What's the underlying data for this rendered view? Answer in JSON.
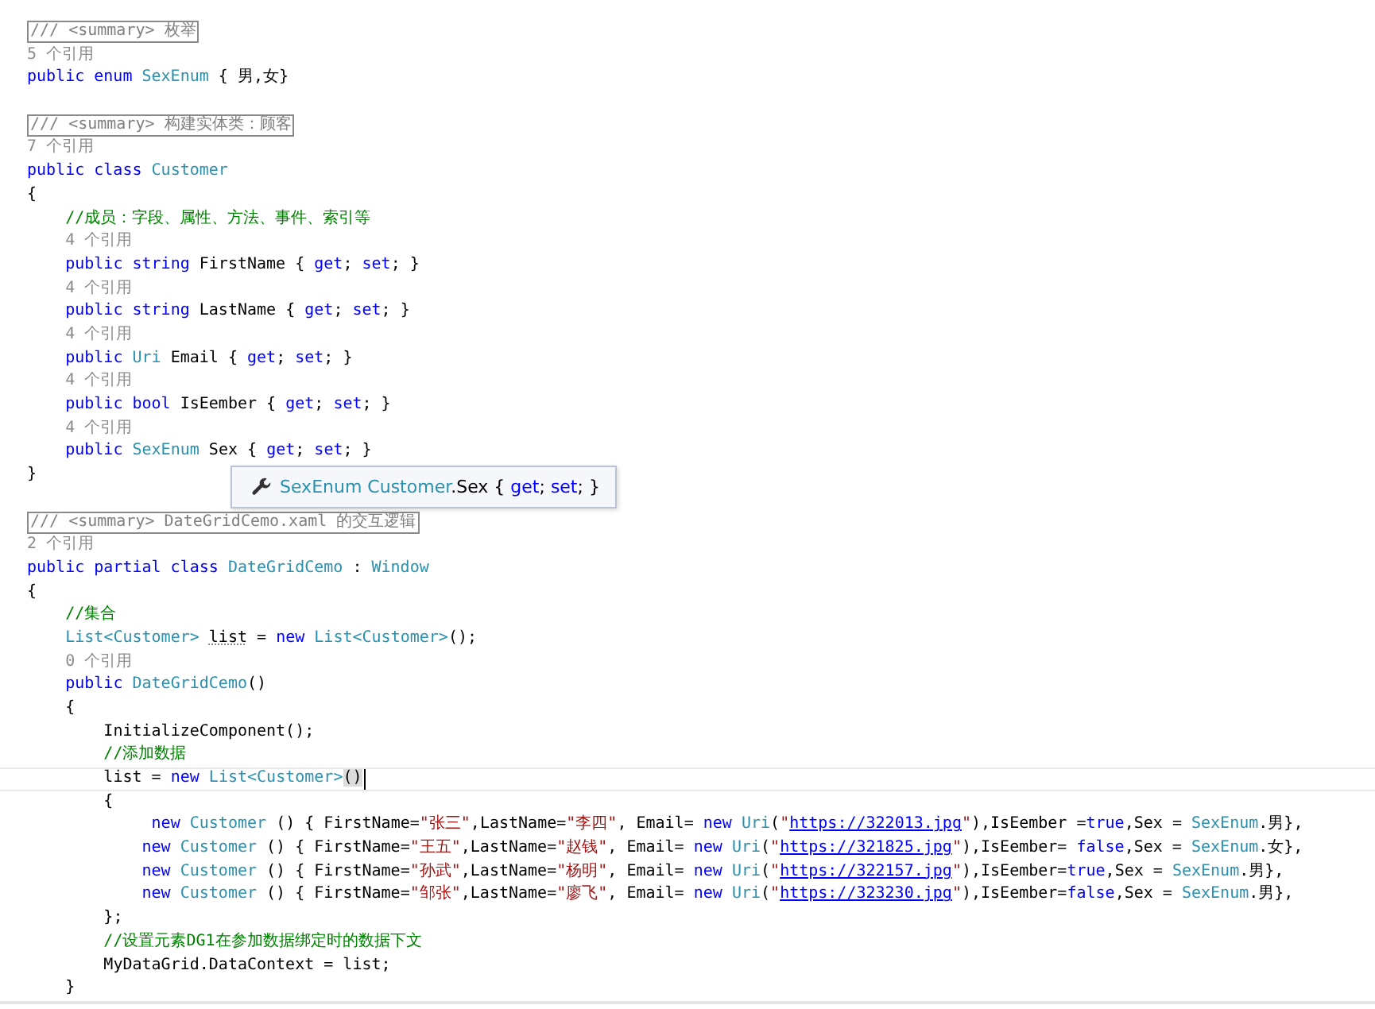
{
  "editor": {
    "lines": [
      {
        "kind": "summary",
        "current": false,
        "text": "/// <summary> 枚举"
      },
      {
        "kind": "refs",
        "current": false,
        "text": "5 个引用"
      },
      {
        "kind": "code",
        "current": false,
        "tokens": [
          {
            "kind": "kw",
            "text": "public enum "
          },
          {
            "kind": "type",
            "text": "SexEnum"
          },
          {
            "kind": "plain",
            "text": " { 男,女}"
          }
        ]
      },
      {
        "kind": "blank",
        "current": false
      },
      {
        "kind": "summary",
        "current": false,
        "text": "/// <summary> 构建实体类：顾客"
      },
      {
        "kind": "refs",
        "current": false,
        "text": "7 个引用"
      },
      {
        "kind": "code",
        "current": false,
        "tokens": [
          {
            "kind": "kw",
            "text": "public class "
          },
          {
            "kind": "type",
            "text": "Customer"
          }
        ]
      },
      {
        "kind": "code",
        "current": false,
        "tokens": [
          {
            "kind": "plain",
            "text": "{"
          }
        ]
      },
      {
        "kind": "code",
        "current": false,
        "tokens": [
          {
            "kind": "comment",
            "text": "    //成员：字段、属性、方法、事件、索引等"
          }
        ]
      },
      {
        "kind": "refs",
        "current": false,
        "text": "    4 个引用"
      },
      {
        "kind": "code",
        "current": false,
        "tokens": [
          {
            "kind": "kw",
            "text": "    public string "
          },
          {
            "kind": "plain",
            "text": "FirstName { "
          },
          {
            "kind": "kw",
            "text": "get"
          },
          {
            "kind": "plain",
            "text": "; "
          },
          {
            "kind": "kw",
            "text": "set"
          },
          {
            "kind": "plain",
            "text": "; }"
          }
        ]
      },
      {
        "kind": "refs",
        "current": false,
        "text": "    4 个引用"
      },
      {
        "kind": "code",
        "current": false,
        "tokens": [
          {
            "kind": "kw",
            "text": "    public string "
          },
          {
            "kind": "plain",
            "text": "LastName { "
          },
          {
            "kind": "kw",
            "text": "get"
          },
          {
            "kind": "plain",
            "text": "; "
          },
          {
            "kind": "kw",
            "text": "set"
          },
          {
            "kind": "plain",
            "text": "; }"
          }
        ]
      },
      {
        "kind": "refs",
        "current": false,
        "text": "    4 个引用"
      },
      {
        "kind": "code",
        "current": false,
        "tokens": [
          {
            "kind": "kw",
            "text": "    public "
          },
          {
            "kind": "type",
            "text": "Uri"
          },
          {
            "kind": "plain",
            "text": " Email { "
          },
          {
            "kind": "kw",
            "text": "get"
          },
          {
            "kind": "plain",
            "text": "; "
          },
          {
            "kind": "kw",
            "text": "set"
          },
          {
            "kind": "plain",
            "text": "; }"
          }
        ]
      },
      {
        "kind": "refs",
        "current": false,
        "text": "    4 个引用"
      },
      {
        "kind": "code",
        "current": false,
        "tokens": [
          {
            "kind": "kw",
            "text": "    public bool "
          },
          {
            "kind": "plain",
            "text": "IsEember { "
          },
          {
            "kind": "kw",
            "text": "get"
          },
          {
            "kind": "plain",
            "text": "; "
          },
          {
            "kind": "kw",
            "text": "set"
          },
          {
            "kind": "plain",
            "text": "; }"
          }
        ]
      },
      {
        "kind": "refs",
        "current": false,
        "text": "    4 个引用"
      },
      {
        "kind": "code",
        "current": false,
        "tokens": [
          {
            "kind": "kw",
            "text": "    public "
          },
          {
            "kind": "type",
            "text": "SexEnum"
          },
          {
            "kind": "plain",
            "text": " Sex { "
          },
          {
            "kind": "kw",
            "text": "get"
          },
          {
            "kind": "plain",
            "text": "; "
          },
          {
            "kind": "kw",
            "text": "set"
          },
          {
            "kind": "plain",
            "text": "; }"
          }
        ]
      },
      {
        "kind": "code",
        "current": false,
        "tokens": [
          {
            "kind": "plain",
            "text": "}"
          }
        ]
      },
      {
        "kind": "blank",
        "current": false
      },
      {
        "kind": "summary",
        "current": false,
        "text": "/// <summary> DateGridCemo.xaml 的交互逻辑"
      },
      {
        "kind": "refs",
        "current": false,
        "text": "2 个引用"
      },
      {
        "kind": "code",
        "current": false,
        "tokens": [
          {
            "kind": "kw",
            "text": "public partial class "
          },
          {
            "kind": "type",
            "text": "DateGridCemo"
          },
          {
            "kind": "plain",
            "text": " : "
          },
          {
            "kind": "type",
            "text": "Window"
          }
        ]
      },
      {
        "kind": "code",
        "current": false,
        "tokens": [
          {
            "kind": "plain",
            "text": "{"
          }
        ]
      },
      {
        "kind": "code",
        "current": false,
        "tokens": [
          {
            "kind": "comment",
            "text": "    //集合"
          }
        ]
      },
      {
        "kind": "code",
        "current": false,
        "tokens": [
          {
            "kind": "type",
            "text": "    List<Customer> "
          },
          {
            "kind": "suggest",
            "text": "list"
          },
          {
            "kind": "plain",
            "text": " = "
          },
          {
            "kind": "kw",
            "text": "new "
          },
          {
            "kind": "type",
            "text": "List<Customer>"
          },
          {
            "kind": "plain",
            "text": "();"
          }
        ]
      },
      {
        "kind": "refs",
        "current": false,
        "text": "    0 个引用"
      },
      {
        "kind": "code",
        "current": false,
        "tokens": [
          {
            "kind": "kw",
            "text": "    public "
          },
          {
            "kind": "type",
            "text": "DateGridCemo"
          },
          {
            "kind": "plain",
            "text": "()"
          }
        ]
      },
      {
        "kind": "code",
        "current": false,
        "tokens": [
          {
            "kind": "plain",
            "text": "    {"
          }
        ]
      },
      {
        "kind": "code",
        "current": false,
        "tokens": [
          {
            "kind": "plain",
            "text": "        InitializeComponent();"
          }
        ]
      },
      {
        "kind": "code",
        "current": false,
        "tokens": [
          {
            "kind": "comment",
            "text": "        //添加数据"
          }
        ]
      },
      {
        "kind": "code",
        "current": true,
        "tokens": [
          {
            "kind": "plain",
            "text": "        list = "
          },
          {
            "kind": "kw",
            "text": "new "
          },
          {
            "kind": "type",
            "text": "List<Customer>"
          },
          {
            "kind": "match",
            "text": "()"
          }
        ]
      },
      {
        "kind": "code",
        "current": false,
        "tokens": [
          {
            "kind": "plain",
            "text": "        {"
          }
        ]
      },
      {
        "kind": "code",
        "current": false,
        "tokens": [
          {
            "kind": "kw",
            "text": "             new "
          },
          {
            "kind": "type",
            "text": "Customer"
          },
          {
            "kind": "plain",
            "text": " () { FirstName="
          },
          {
            "kind": "str",
            "text": "\"张三\""
          },
          {
            "kind": "plain",
            "text": ",LastName="
          },
          {
            "kind": "str",
            "text": "\"李四\""
          },
          {
            "kind": "plain",
            "text": ", Email= "
          },
          {
            "kind": "kw",
            "text": "new "
          },
          {
            "kind": "type",
            "text": "Uri"
          },
          {
            "kind": "plain",
            "text": "("
          },
          {
            "kind": "str",
            "text": "\""
          },
          {
            "kind": "link",
            "text": "https://322013.jpg"
          },
          {
            "kind": "str",
            "text": "\""
          },
          {
            "kind": "plain",
            "text": "),IsEember ="
          },
          {
            "kind": "kw",
            "text": "true"
          },
          {
            "kind": "plain",
            "text": ",Sex = "
          },
          {
            "kind": "type",
            "text": "SexEnum"
          },
          {
            "kind": "plain",
            "text": ".男},"
          }
        ]
      },
      {
        "kind": "code",
        "current": false,
        "tokens": [
          {
            "kind": "kw",
            "text": "            new "
          },
          {
            "kind": "type",
            "text": "Customer"
          },
          {
            "kind": "plain",
            "text": " () { FirstName="
          },
          {
            "kind": "str",
            "text": "\"王五\""
          },
          {
            "kind": "plain",
            "text": ",LastName="
          },
          {
            "kind": "str",
            "text": "\"赵钱\""
          },
          {
            "kind": "plain",
            "text": ", Email= "
          },
          {
            "kind": "kw",
            "text": "new "
          },
          {
            "kind": "type",
            "text": "Uri"
          },
          {
            "kind": "plain",
            "text": "("
          },
          {
            "kind": "str",
            "text": "\""
          },
          {
            "kind": "link",
            "text": "https://321825.jpg"
          },
          {
            "kind": "str",
            "text": "\""
          },
          {
            "kind": "plain",
            "text": "),IsEember= "
          },
          {
            "kind": "kw",
            "text": "false"
          },
          {
            "kind": "plain",
            "text": ",Sex = "
          },
          {
            "kind": "type",
            "text": "SexEnum"
          },
          {
            "kind": "plain",
            "text": ".女},"
          }
        ]
      },
      {
        "kind": "code",
        "current": false,
        "tokens": [
          {
            "kind": "kw",
            "text": "            new "
          },
          {
            "kind": "type",
            "text": "Customer"
          },
          {
            "kind": "plain",
            "text": " () { FirstName="
          },
          {
            "kind": "str",
            "text": "\"孙武\""
          },
          {
            "kind": "plain",
            "text": ",LastName="
          },
          {
            "kind": "str",
            "text": "\"杨明\""
          },
          {
            "kind": "plain",
            "text": ", Email= "
          },
          {
            "kind": "kw",
            "text": "new "
          },
          {
            "kind": "type",
            "text": "Uri"
          },
          {
            "kind": "plain",
            "text": "("
          },
          {
            "kind": "str",
            "text": "\""
          },
          {
            "kind": "link",
            "text": "https://322157.jpg"
          },
          {
            "kind": "str",
            "text": "\""
          },
          {
            "kind": "plain",
            "text": "),IsEember="
          },
          {
            "kind": "kw",
            "text": "true"
          },
          {
            "kind": "plain",
            "text": ",Sex = "
          },
          {
            "kind": "type",
            "text": "SexEnum"
          },
          {
            "kind": "plain",
            "text": ".男},"
          }
        ]
      },
      {
        "kind": "code",
        "current": false,
        "tokens": [
          {
            "kind": "kw",
            "text": "            new "
          },
          {
            "kind": "type",
            "text": "Customer"
          },
          {
            "kind": "plain",
            "text": " () { FirstName="
          },
          {
            "kind": "str",
            "text": "\"邹张\""
          },
          {
            "kind": "plain",
            "text": ",LastName="
          },
          {
            "kind": "str",
            "text": "\"廖飞\""
          },
          {
            "kind": "plain",
            "text": ", Email= "
          },
          {
            "kind": "kw",
            "text": "new "
          },
          {
            "kind": "type",
            "text": "Uri"
          },
          {
            "kind": "plain",
            "text": "("
          },
          {
            "kind": "str",
            "text": "\""
          },
          {
            "kind": "link",
            "text": "https://323230.jpg"
          },
          {
            "kind": "str",
            "text": "\""
          },
          {
            "kind": "plain",
            "text": "),IsEember="
          },
          {
            "kind": "kw",
            "text": "false"
          },
          {
            "kind": "plain",
            "text": ",Sex = "
          },
          {
            "kind": "type",
            "text": "SexEnum"
          },
          {
            "kind": "plain",
            "text": ".男},"
          }
        ]
      },
      {
        "kind": "code",
        "current": false,
        "tokens": [
          {
            "kind": "plain",
            "text": "        };"
          }
        ]
      },
      {
        "kind": "code",
        "current": false,
        "tokens": [
          {
            "kind": "comment",
            "text": "        //设置元素DG1在参加数据绑定时的数据下文"
          }
        ]
      },
      {
        "kind": "code",
        "current": false,
        "tokens": [
          {
            "kind": "plain",
            "text": "        MyDataGrid.DataContext = list;"
          }
        ]
      },
      {
        "kind": "code",
        "current": false,
        "tokens": [
          {
            "kind": "plain",
            "text": "    }"
          }
        ]
      }
    ],
    "tooltip": {
      "tokens": [
        {
          "kind": "type",
          "text": "SexEnum Customer"
        },
        {
          "kind": "plain",
          "text": ".Sex { "
        },
        {
          "kind": "kw",
          "text": "get"
        },
        {
          "kind": "plain",
          "text": "; "
        },
        {
          "kind": "kw",
          "text": "set"
        },
        {
          "kind": "plain",
          "text": "; }"
        }
      ]
    }
  }
}
